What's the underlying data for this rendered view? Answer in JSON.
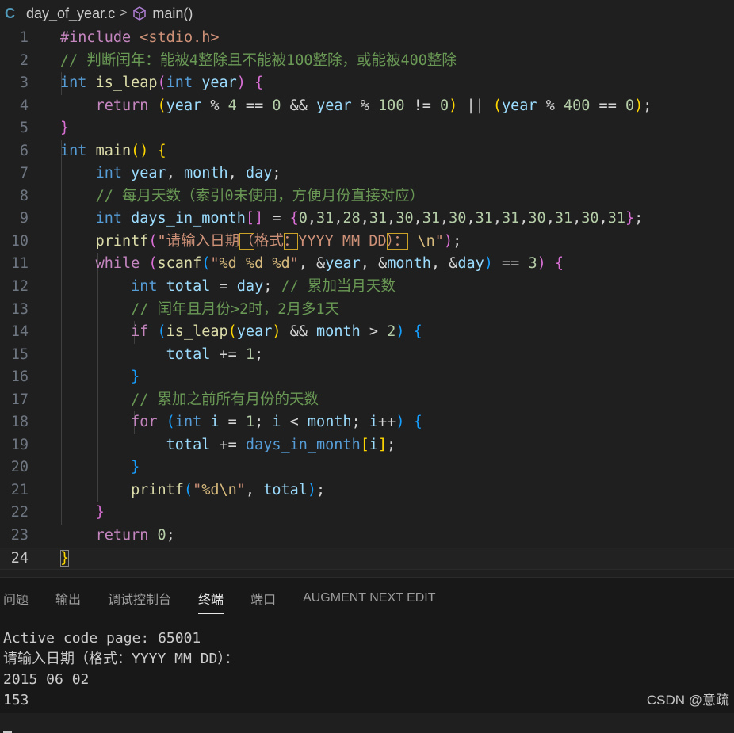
{
  "breadcrumb": {
    "lang_badge": "C",
    "file": "day_of_year.c",
    "separator": ">",
    "symbol_icon": "cube-icon",
    "symbol": "main()"
  },
  "editor": {
    "line_numbers": [
      "1",
      "2",
      "3",
      "4",
      "5",
      "6",
      "7",
      "8",
      "9",
      "10",
      "11",
      "12",
      "13",
      "14",
      "15",
      "16",
      "17",
      "18",
      "19",
      "20",
      "21",
      "22",
      "23",
      "24"
    ],
    "active_line": 24,
    "lines": [
      [
        [
          "c",
          "#include "
        ],
        [
          "s",
          "<stdio.h>"
        ]
      ],
      [
        [
          "cm",
          "// 判断闰年：能被4整除且不能被100整除，或能被400整除"
        ]
      ],
      [
        [
          "k",
          "int "
        ],
        [
          "f",
          "is_leap"
        ],
        [
          "b2",
          "("
        ],
        [
          "k",
          "int "
        ],
        [
          "v",
          "year"
        ],
        [
          "b2",
          ")"
        ],
        [
          "p",
          " "
        ],
        [
          "b2",
          "{"
        ]
      ],
      [
        [
          "p",
          "    "
        ],
        [
          "c",
          "return "
        ],
        [
          "b1",
          "("
        ],
        [
          "v",
          "year"
        ],
        [
          "p",
          " % "
        ],
        [
          "n",
          "4"
        ],
        [
          "p",
          " == "
        ],
        [
          "n",
          "0"
        ],
        [
          "p",
          " && "
        ],
        [
          "v",
          "year"
        ],
        [
          "p",
          " % "
        ],
        [
          "n",
          "100"
        ],
        [
          "p",
          " != "
        ],
        [
          "n",
          "0"
        ],
        [
          "b1",
          ")"
        ],
        [
          "p",
          " || "
        ],
        [
          "b1",
          "("
        ],
        [
          "v",
          "year"
        ],
        [
          "p",
          " % "
        ],
        [
          "n",
          "400"
        ],
        [
          "p",
          " == "
        ],
        [
          "n",
          "0"
        ],
        [
          "b1",
          ")"
        ],
        [
          "p",
          ";"
        ]
      ],
      [
        [
          "b2",
          "}"
        ]
      ],
      [
        [
          "k",
          "int "
        ],
        [
          "f",
          "main"
        ],
        [
          "b1",
          "()"
        ],
        [
          "p",
          " "
        ],
        [
          "b1",
          "{"
        ]
      ],
      [
        [
          "p",
          "    "
        ],
        [
          "k",
          "int "
        ],
        [
          "v",
          "year"
        ],
        [
          "p",
          ", "
        ],
        [
          "v",
          "month"
        ],
        [
          "p",
          ", "
        ],
        [
          "v",
          "day"
        ],
        [
          "p",
          ";"
        ]
      ],
      [
        [
          "p",
          "    "
        ],
        [
          "cm",
          "// 每月天数（索引0未使用，方便月份直接对应）"
        ]
      ],
      [
        [
          "p",
          "    "
        ],
        [
          "k",
          "int "
        ],
        [
          "v",
          "days_in_month"
        ],
        [
          "b2",
          "[]"
        ],
        [
          "p",
          " = "
        ],
        [
          "b2",
          "{"
        ],
        [
          "n",
          "0"
        ],
        [
          "p",
          ","
        ],
        [
          "n",
          "31"
        ],
        [
          "p",
          ","
        ],
        [
          "n",
          "28"
        ],
        [
          "p",
          ","
        ],
        [
          "n",
          "31"
        ],
        [
          "p",
          ","
        ],
        [
          "n",
          "30"
        ],
        [
          "p",
          ","
        ],
        [
          "n",
          "31"
        ],
        [
          "p",
          ","
        ],
        [
          "n",
          "30"
        ],
        [
          "p",
          ","
        ],
        [
          "n",
          "31"
        ],
        [
          "p",
          ","
        ],
        [
          "n",
          "31"
        ],
        [
          "p",
          ","
        ],
        [
          "n",
          "30"
        ],
        [
          "p",
          ","
        ],
        [
          "n",
          "31"
        ],
        [
          "p",
          ","
        ],
        [
          "n",
          "30"
        ],
        [
          "p",
          ","
        ],
        [
          "n",
          "31"
        ],
        [
          "b2",
          "}"
        ],
        [
          "p",
          ";"
        ]
      ],
      [
        [
          "p",
          "    "
        ],
        [
          "f",
          "printf"
        ],
        [
          "b2",
          "("
        ],
        [
          "s",
          "\"请输入日期"
        ],
        [
          "s box",
          "（"
        ],
        [
          "s",
          "格式"
        ],
        [
          "s box",
          "："
        ],
        [
          "s",
          "YYYY MM DD"
        ],
        [
          "s box",
          "）："
        ],
        [
          "s",
          " "
        ],
        [
          "e",
          "\\n"
        ],
        [
          "s",
          "\""
        ],
        [
          "b2",
          ")"
        ],
        [
          "p",
          ";"
        ]
      ],
      [
        [
          "p",
          "    "
        ],
        [
          "c",
          "while "
        ],
        [
          "b2",
          "("
        ],
        [
          "f",
          "scanf"
        ],
        [
          "b3",
          "("
        ],
        [
          "s",
          "\""
        ],
        [
          "e",
          "%d"
        ],
        [
          "s",
          " "
        ],
        [
          "e",
          "%d"
        ],
        [
          "s",
          " "
        ],
        [
          "e",
          "%d"
        ],
        [
          "s",
          "\""
        ],
        [
          "p",
          ", &"
        ],
        [
          "v",
          "year"
        ],
        [
          "p",
          ", &"
        ],
        [
          "v",
          "month"
        ],
        [
          "p",
          ", &"
        ],
        [
          "v",
          "day"
        ],
        [
          "b3",
          ")"
        ],
        [
          "p",
          " == "
        ],
        [
          "n",
          "3"
        ],
        [
          "b2",
          ")"
        ],
        [
          "p",
          " "
        ],
        [
          "b2",
          "{"
        ]
      ],
      [
        [
          "p",
          "        "
        ],
        [
          "k",
          "int "
        ],
        [
          "v",
          "total"
        ],
        [
          "p",
          " = "
        ],
        [
          "v",
          "day"
        ],
        [
          "p",
          "; "
        ],
        [
          "cm",
          "// 累加当月天数"
        ]
      ],
      [
        [
          "p",
          "        "
        ],
        [
          "cm",
          "// 闰年且月份>2时，2月多1天"
        ]
      ],
      [
        [
          "p",
          "        "
        ],
        [
          "c",
          "if "
        ],
        [
          "b3",
          "("
        ],
        [
          "f",
          "is_leap"
        ],
        [
          "b1",
          "("
        ],
        [
          "v",
          "year"
        ],
        [
          "b1",
          ")"
        ],
        [
          "p",
          " && "
        ],
        [
          "v",
          "month"
        ],
        [
          "p",
          " > "
        ],
        [
          "n",
          "2"
        ],
        [
          "b3",
          ")"
        ],
        [
          "p",
          " "
        ],
        [
          "b3",
          "{"
        ]
      ],
      [
        [
          "p",
          "            "
        ],
        [
          "v",
          "total"
        ],
        [
          "p",
          " += "
        ],
        [
          "n",
          "1"
        ],
        [
          "p",
          ";"
        ]
      ],
      [
        [
          "p",
          "        "
        ],
        [
          "b3",
          "}"
        ]
      ],
      [
        [
          "p",
          "        "
        ],
        [
          "cm",
          "// 累加之前所有月份的天数"
        ]
      ],
      [
        [
          "p",
          "        "
        ],
        [
          "c",
          "for "
        ],
        [
          "b3",
          "("
        ],
        [
          "k",
          "int "
        ],
        [
          "v",
          "i"
        ],
        [
          "p",
          " = "
        ],
        [
          "n",
          "1"
        ],
        [
          "p",
          "; "
        ],
        [
          "v",
          "i"
        ],
        [
          "p",
          " < "
        ],
        [
          "v",
          "month"
        ],
        [
          "p",
          "; "
        ],
        [
          "v",
          "i"
        ],
        [
          "p",
          "++"
        ],
        [
          "b3",
          ")"
        ],
        [
          "p",
          " "
        ],
        [
          "b3",
          "{"
        ]
      ],
      [
        [
          "p",
          "            "
        ],
        [
          "v",
          "total"
        ],
        [
          "p",
          " += "
        ],
        [
          "k",
          "days_in_month"
        ],
        [
          "b1",
          "["
        ],
        [
          "v",
          "i"
        ],
        [
          "b1",
          "]"
        ],
        [
          "p",
          ";"
        ]
      ],
      [
        [
          "p",
          "        "
        ],
        [
          "b3",
          "}"
        ]
      ],
      [
        [
          "p",
          "        "
        ],
        [
          "f",
          "printf"
        ],
        [
          "b3",
          "("
        ],
        [
          "s",
          "\""
        ],
        [
          "e",
          "%d\\n"
        ],
        [
          "s",
          "\""
        ],
        [
          "p",
          ", "
        ],
        [
          "v",
          "total"
        ],
        [
          "b3",
          ")"
        ],
        [
          "p",
          ";"
        ]
      ],
      [
        [
          "p",
          "    "
        ],
        [
          "b2",
          "}"
        ]
      ],
      [
        [
          "p",
          "    "
        ],
        [
          "c",
          "return "
        ],
        [
          "n",
          "0"
        ],
        [
          "p",
          ";"
        ]
      ],
      [
        [
          "b1 cursor-br",
          "}"
        ]
      ]
    ]
  },
  "panel": {
    "tabs": [
      "问题",
      "输出",
      "调试控制台",
      "终端",
      "端口",
      "AUGMENT NEXT EDIT"
    ],
    "active_tab": "终端",
    "terminal_lines": [
      "Active code page: 65001",
      "请输入日期（格式：YYYY MM DD）：",
      "2015 06 02",
      "153"
    ]
  },
  "watermark": "CSDN @意疏"
}
